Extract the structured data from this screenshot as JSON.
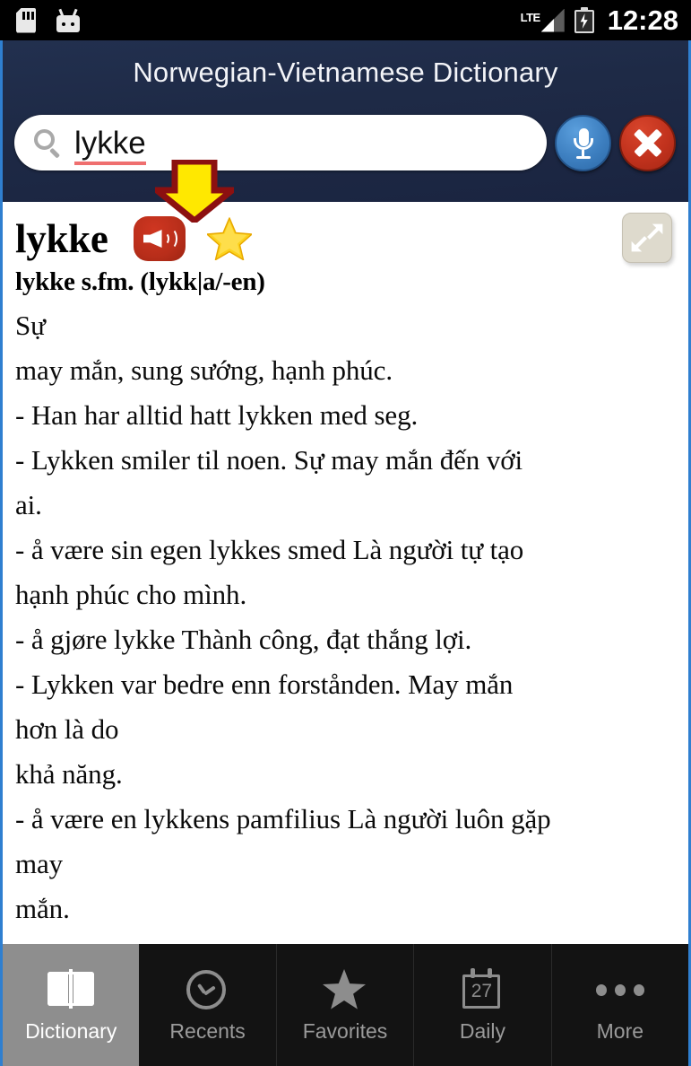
{
  "statusbar": {
    "icons": [
      "sd-card-icon",
      "android-robot-icon"
    ],
    "network_label": "LTE",
    "signal": "signal-bars-icon",
    "battery": "battery-charging-icon",
    "time": "12:28"
  },
  "header": {
    "title": "Norwegian-Vietnamese Dictionary",
    "accent_color": "#2f7fd0",
    "background_color": "#1e2a46"
  },
  "search": {
    "icon": "search-icon",
    "value": "lykke",
    "placeholder": "",
    "spellcheck_underline_color": "#ef6f6f",
    "mic_button": "microphone-icon",
    "clear_button": "close-x-icon"
  },
  "annotation": {
    "arrow": "down-arrow-pointer",
    "fill_color": "#ffe800",
    "stroke_color": "#8c1010"
  },
  "entry": {
    "headword": "lykke",
    "speak_icon": "speaker-icon",
    "favorite_icon": "star-icon",
    "expand_icon": "expand-fullscreen-icon",
    "pronunciation": "lykke s.fm. (lykk|a/-en)",
    "definition_lines": [
      "Sự",
      "may mắn, sung sướng, hạnh phúc.",
      "- Han har alltid hatt lykken med seg.",
      "- Lykken smiler til noen. Sự may mắn đến với",
      "ai.",
      "- å være sin egen lykkes smed Là người tự tạo",
      "hạnh phúc cho mình.",
      "- å gjøre lykke Thành công, đạt thắng lợi.",
      "- Lykken var bedre enn forstånden. May mắn",
      "hơn là do",
      "khả năng.",
      "- å være en lykkens pamfilius Là người luôn gặp",
      "may",
      "mắn."
    ]
  },
  "tabbar": {
    "active_index": 0,
    "items": [
      {
        "label": "Dictionary",
        "icon": "book-icon"
      },
      {
        "label": "Recents",
        "icon": "clock-check-icon"
      },
      {
        "label": "Favorites",
        "icon": "star-icon"
      },
      {
        "label": "Daily",
        "icon": "calendar-icon",
        "badge": "27"
      },
      {
        "label": "More",
        "icon": "ellipsis-icon"
      }
    ]
  }
}
